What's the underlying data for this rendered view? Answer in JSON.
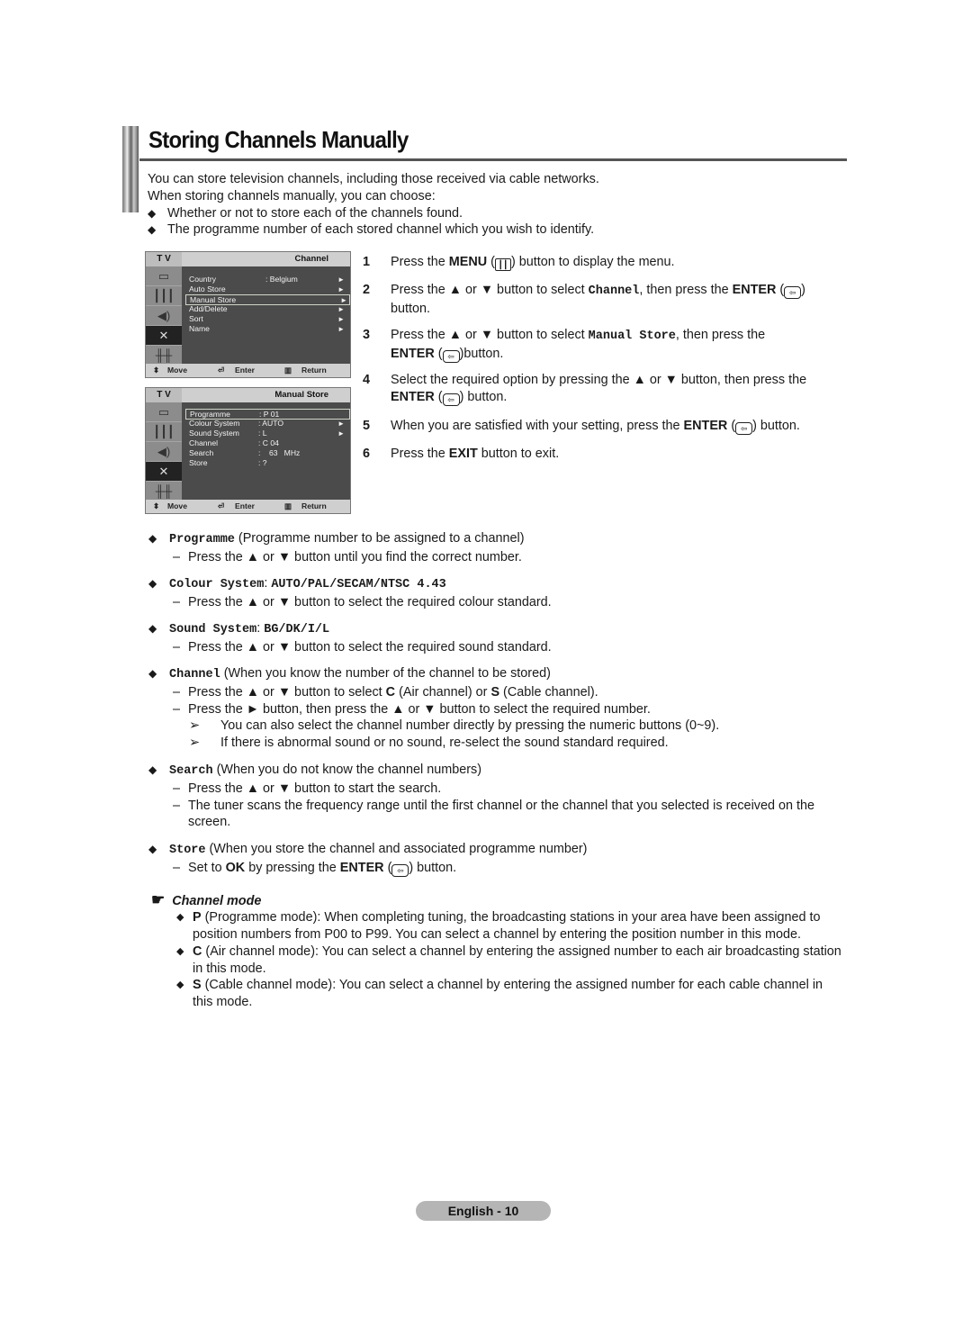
{
  "title": "Storing Channels Manually",
  "intro": {
    "line1": "You can store television channels, including those received via cable networks.",
    "line2": "When storing channels manually, you can choose:",
    "bullets": [
      "Whether or not to store each of the channels found.",
      "The programme number of each stored channel which you wish to identify."
    ]
  },
  "icons": {
    "bullet": "◆",
    "up": "▲",
    "down": "▼",
    "right": "►",
    "menu": "┃┃┃",
    "enter": "⇦",
    "note_arrow": "➢",
    "hand": "☛"
  },
  "tv_channel_menu": {
    "tv_label": "T V",
    "title": "Channel",
    "side_icons": [
      "picture-icon",
      "menu-icon",
      "sound-icon",
      "channel-antenna-icon",
      "setup-sliders-icon"
    ],
    "active_side_index": 3,
    "rows": [
      {
        "label": "Country",
        "value": ": Belgium",
        "arrow": "►",
        "selected": false
      },
      {
        "label": "Auto Store",
        "value": "",
        "arrow": "►",
        "selected": false
      },
      {
        "label": "Manual Store",
        "value": "",
        "arrow": "►",
        "selected": true
      },
      {
        "label": "Add/Delete",
        "value": "",
        "arrow": "►",
        "selected": false
      },
      {
        "label": "Sort",
        "value": "",
        "arrow": "►",
        "selected": false
      },
      {
        "label": "Name",
        "value": "",
        "arrow": "►",
        "selected": false
      }
    ],
    "footer": {
      "move": "Move",
      "enter": "Enter",
      "return": "Return"
    }
  },
  "tv_manual_store_menu": {
    "tv_label": "T V",
    "title": "Manual Store",
    "rows": [
      {
        "label": "Programme",
        "value": ": P  01",
        "arrow": "",
        "selected": true
      },
      {
        "label": "Colour System",
        "value": ": AUTO",
        "arrow": "►",
        "selected": false
      },
      {
        "label": "Sound System",
        "value": ": L",
        "arrow": "►",
        "selected": false
      },
      {
        "label": "Channel",
        "value": ": C  04",
        "arrow": "",
        "selected": false
      },
      {
        "label": "Search",
        "value": ":    63   MHz",
        "arrow": "",
        "selected": false
      },
      {
        "label": "Store",
        "value": ": ?",
        "arrow": "",
        "selected": false
      }
    ],
    "footer": {
      "move": "Move",
      "enter": "Enter",
      "return": "Return"
    }
  },
  "steps": [
    {
      "num": "1",
      "a": "Press the ",
      "b": "MENU",
      "c": " (",
      "d": ") button to display the menu."
    },
    {
      "num": "2",
      "a": "Press the ▲ or ▼ button to select ",
      "mono": "Channel",
      "c": ", then press the ",
      "b": "ENTER",
      "d": " (",
      "e": ")",
      "f": "button."
    },
    {
      "num": "3",
      "a": "Press the ▲ or ▼ button to select ",
      "mono": "Manual Store",
      "c": ", then press the",
      "b": "ENTER",
      "d": " (",
      "e": ")button."
    },
    {
      "num": "4",
      "a": "Select the required option by pressing the ▲ or ▼ button, then press the",
      "b": "ENTER",
      "d": " (",
      "e": ") button."
    },
    {
      "num": "5",
      "a": "When you are satisfied with your setting, press the ",
      "b": "ENTER",
      "d": " (",
      "e": ") button."
    },
    {
      "num": "6",
      "a": "Press the ",
      "b": "EXIT",
      "e": " button to exit."
    }
  ],
  "details": {
    "programme": {
      "term": "Programme",
      "desc": " (Programme number to be assigned to a channel)",
      "sub": [
        "Press the ▲ or ▼ button until you find the correct number."
      ]
    },
    "colour": {
      "term": "Colour System",
      "sep": ": ",
      "values": "AUTO/PAL/SECAM/NTSC 4.43",
      "sub": [
        "Press the ▲ or ▼ button to select the required colour standard."
      ]
    },
    "sound": {
      "term": "Sound System",
      "sep": ": ",
      "values": "BG/DK/I/L",
      "sub": [
        "Press the ▲ or ▼ button to select the required sound standard."
      ]
    },
    "channel": {
      "term": "Channel",
      "desc": " (When you know the number of the channel to be stored)",
      "sub1_a": "Press the ▲ or ▼ button to select ",
      "sub1_c": "C",
      "sub1_b": " (Air channel) or ",
      "sub1_s": "S",
      "sub1_d": " (Cable channel).",
      "sub2": "Press the ► button, then press the ▲ or ▼ button to select the required number.",
      "notes": [
        "You can also select the channel number directly by pressing the numeric buttons (0~9).",
        "If there is abnormal sound or no sound, re-select the sound standard required."
      ]
    },
    "search": {
      "term": "Search",
      "desc": " (When you do not know the channel numbers)",
      "sub": [
        "Press the ▲ or ▼ button to start the search.",
        "The tuner scans the frequency range until the first channel or the channel that you selected is received on the screen."
      ]
    },
    "store": {
      "term": "Store",
      "desc": " (When you store the channel and associated programme number)",
      "sub_a": "Set to ",
      "sub_ok": "OK",
      "sub_b": " by pressing the ",
      "sub_enter": "ENTER",
      "sub_c": " (",
      "sub_d": ") button."
    }
  },
  "channel_mode": {
    "heading": "Channel mode",
    "items": [
      {
        "key": "P",
        "text": " (Programme mode): When completing tuning, the broadcasting stations in your area have been assigned to position numbers from P00 to P99. You can select a channel by entering the position number in this mode."
      },
      {
        "key": "C",
        "text": " (Air channel mode): You can select a channel by entering the assigned number to each air broadcasting station in this mode."
      },
      {
        "key": "S",
        "text": " (Cable channel mode): You can select a channel by entering the assigned number for each cable channel in this mode."
      }
    ]
  },
  "footer": {
    "page_label": "English - 10"
  }
}
